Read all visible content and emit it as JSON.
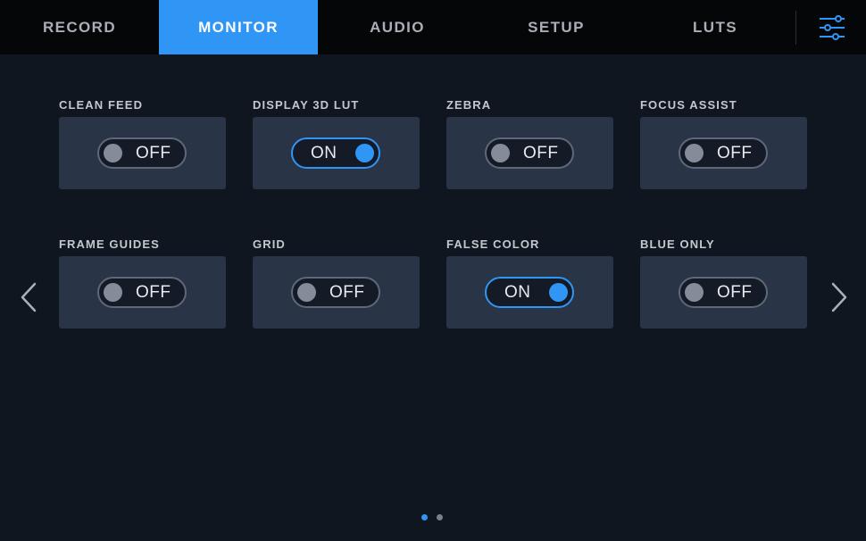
{
  "tabs": [
    {
      "label": "RECORD",
      "active": false
    },
    {
      "label": "MONITOR",
      "active": true
    },
    {
      "label": "AUDIO",
      "active": false
    },
    {
      "label": "SETUP",
      "active": false
    },
    {
      "label": "LUTS",
      "active": false
    }
  ],
  "settings_icon": "sliders-icon",
  "colors": {
    "accent": "#2f96f5",
    "background": "#101620",
    "tabbar": "#050608",
    "panel": "#2a3447"
  },
  "toggles": [
    {
      "label": "CLEAN FEED",
      "state": "OFF"
    },
    {
      "label": "DISPLAY 3D LUT",
      "state": "ON"
    },
    {
      "label": "ZEBRA",
      "state": "OFF"
    },
    {
      "label": "FOCUS ASSIST",
      "state": "OFF"
    },
    {
      "label": "FRAME GUIDES",
      "state": "OFF"
    },
    {
      "label": "GRID",
      "state": "OFF"
    },
    {
      "label": "FALSE COLOR",
      "state": "ON"
    },
    {
      "label": "BLUE ONLY",
      "state": "OFF"
    }
  ],
  "pagination": {
    "current_page": 1,
    "total_pages": 2
  },
  "nav_icons": {
    "prev": "chevron-left-icon",
    "next": "chevron-right-icon"
  }
}
